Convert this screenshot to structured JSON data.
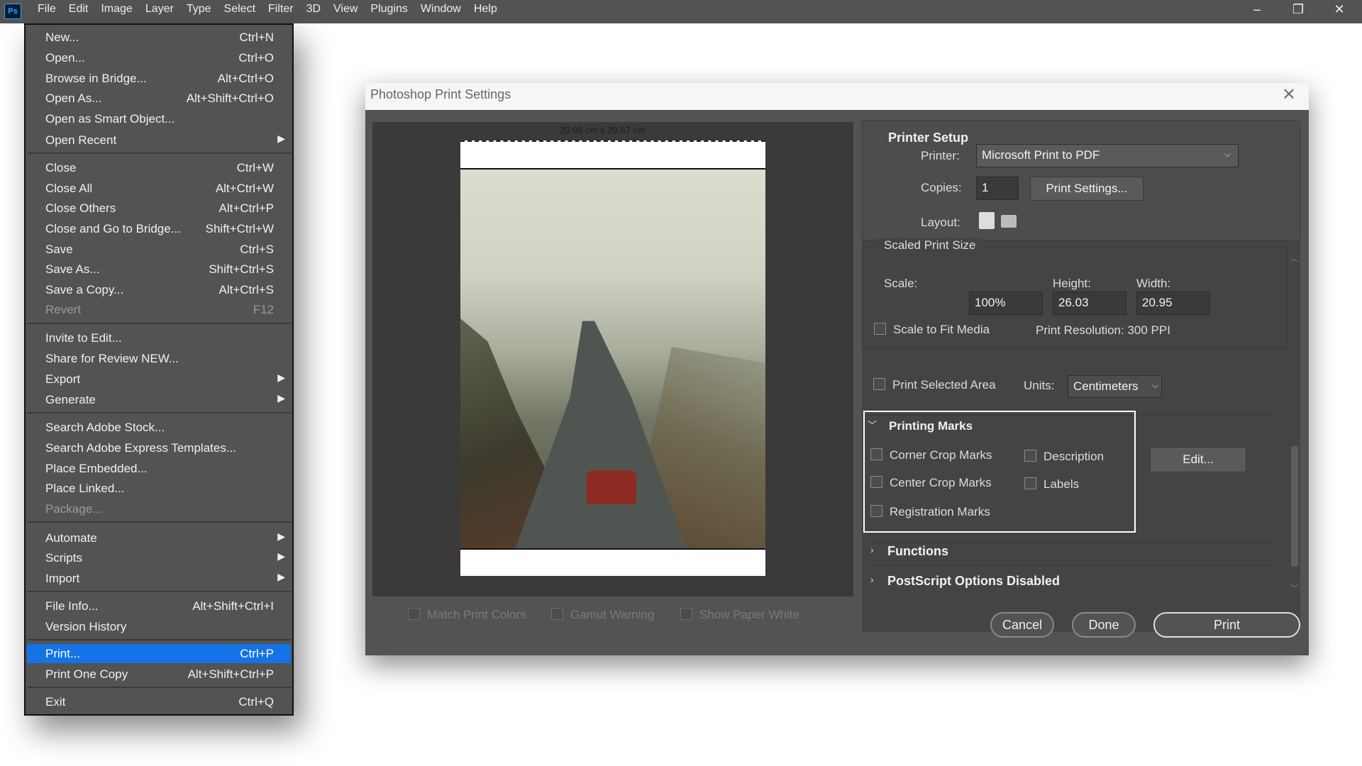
{
  "app": {
    "logo_text": "Ps",
    "menubar": [
      "File",
      "Edit",
      "Image",
      "Layer",
      "Type",
      "Select",
      "Filter",
      "3D",
      "View",
      "Plugins",
      "Window",
      "Help"
    ],
    "window_controls": {
      "minimize": "–",
      "restore": "❐",
      "close": "✕"
    }
  },
  "file_menu": {
    "items": [
      {
        "label": "New...",
        "shortcut": "Ctrl+N"
      },
      {
        "label": "Open...",
        "shortcut": "Ctrl+O"
      },
      {
        "label": "Browse in Bridge...",
        "shortcut": "Alt+Ctrl+O"
      },
      {
        "label": "Open As...",
        "shortcut": "Alt+Shift+Ctrl+O"
      },
      {
        "label": "Open as Smart Object...",
        "shortcut": ""
      },
      {
        "label": "Open Recent",
        "shortcut": "",
        "submenu": true
      },
      {
        "label": "Close",
        "shortcut": "Ctrl+W"
      },
      {
        "label": "Close All",
        "shortcut": "Alt+Ctrl+W"
      },
      {
        "label": "Close Others",
        "shortcut": "Alt+Ctrl+P"
      },
      {
        "label": "Close and Go to Bridge...",
        "shortcut": "Shift+Ctrl+W"
      },
      {
        "label": "Save",
        "shortcut": "Ctrl+S"
      },
      {
        "label": "Save As...",
        "shortcut": "Shift+Ctrl+S"
      },
      {
        "label": "Save a Copy...",
        "shortcut": "Alt+Ctrl+S"
      },
      {
        "label": "Revert",
        "shortcut": "F12",
        "disabled": true
      },
      {
        "label": "Invite to Edit...",
        "shortcut": ""
      },
      {
        "label": "Share for Review NEW...",
        "shortcut": ""
      },
      {
        "label": "Export",
        "shortcut": "",
        "submenu": true
      },
      {
        "label": "Generate",
        "shortcut": "",
        "submenu": true
      },
      {
        "label": "Search Adobe Stock...",
        "shortcut": ""
      },
      {
        "label": "Search Adobe Express Templates...",
        "shortcut": ""
      },
      {
        "label": "Place Embedded...",
        "shortcut": ""
      },
      {
        "label": "Place Linked...",
        "shortcut": ""
      },
      {
        "label": "Package...",
        "shortcut": "",
        "disabled": true
      },
      {
        "label": "Automate",
        "shortcut": "",
        "submenu": true
      },
      {
        "label": "Scripts",
        "shortcut": "",
        "submenu": true
      },
      {
        "label": "Import",
        "shortcut": "",
        "submenu": true
      },
      {
        "label": "File Info...",
        "shortcut": "Alt+Shift+Ctrl+I"
      },
      {
        "label": "Version History",
        "shortcut": ""
      },
      {
        "label": "Print...",
        "shortcut": "Ctrl+P",
        "selected": true
      },
      {
        "label": "Print One Copy",
        "shortcut": "Alt+Shift+Ctrl+P"
      },
      {
        "label": "Exit",
        "shortcut": "Ctrl+Q"
      }
    ]
  },
  "dialog": {
    "title": "Photoshop Print Settings",
    "close": "✕",
    "preview": {
      "size_label": "20.99 cm x 29.67 cm"
    },
    "bottom_options": [
      "Match Print Colors",
      "Gamut Warning",
      "Show Paper White"
    ],
    "printer_setup": {
      "header": "Printer Setup",
      "printer_label": "Printer:",
      "printer_value": "Microsoft Print to PDF",
      "copies_label": "Copies:",
      "copies_value": "1",
      "print_settings_button": "Print Settings...",
      "layout_label": "Layout:"
    },
    "scaled_print_size": {
      "header": "Scaled Print Size",
      "scale_label": "Scale:",
      "height_label": "Height:",
      "width_label": "Width:",
      "scale_value": "100%",
      "height_value": "26.03",
      "width_value": "20.95",
      "scale_to_fit": "Scale to Fit Media",
      "print_resolution": "Print Resolution: 300 PPI"
    },
    "print_selected_area": "Print Selected Area",
    "units_label": "Units:",
    "units_value": "Centimeters",
    "printing_marks": {
      "header": "Printing Marks",
      "corner_crop": "Corner Crop Marks",
      "center_crop": "Center Crop Marks",
      "registration": "Registration Marks",
      "description": "Description",
      "labels": "Labels",
      "edit_button": "Edit..."
    },
    "functions_header": "Functions",
    "postscript_header": "PostScript Options Disabled",
    "buttons": {
      "cancel": "Cancel",
      "done": "Done",
      "print": "Print"
    }
  }
}
